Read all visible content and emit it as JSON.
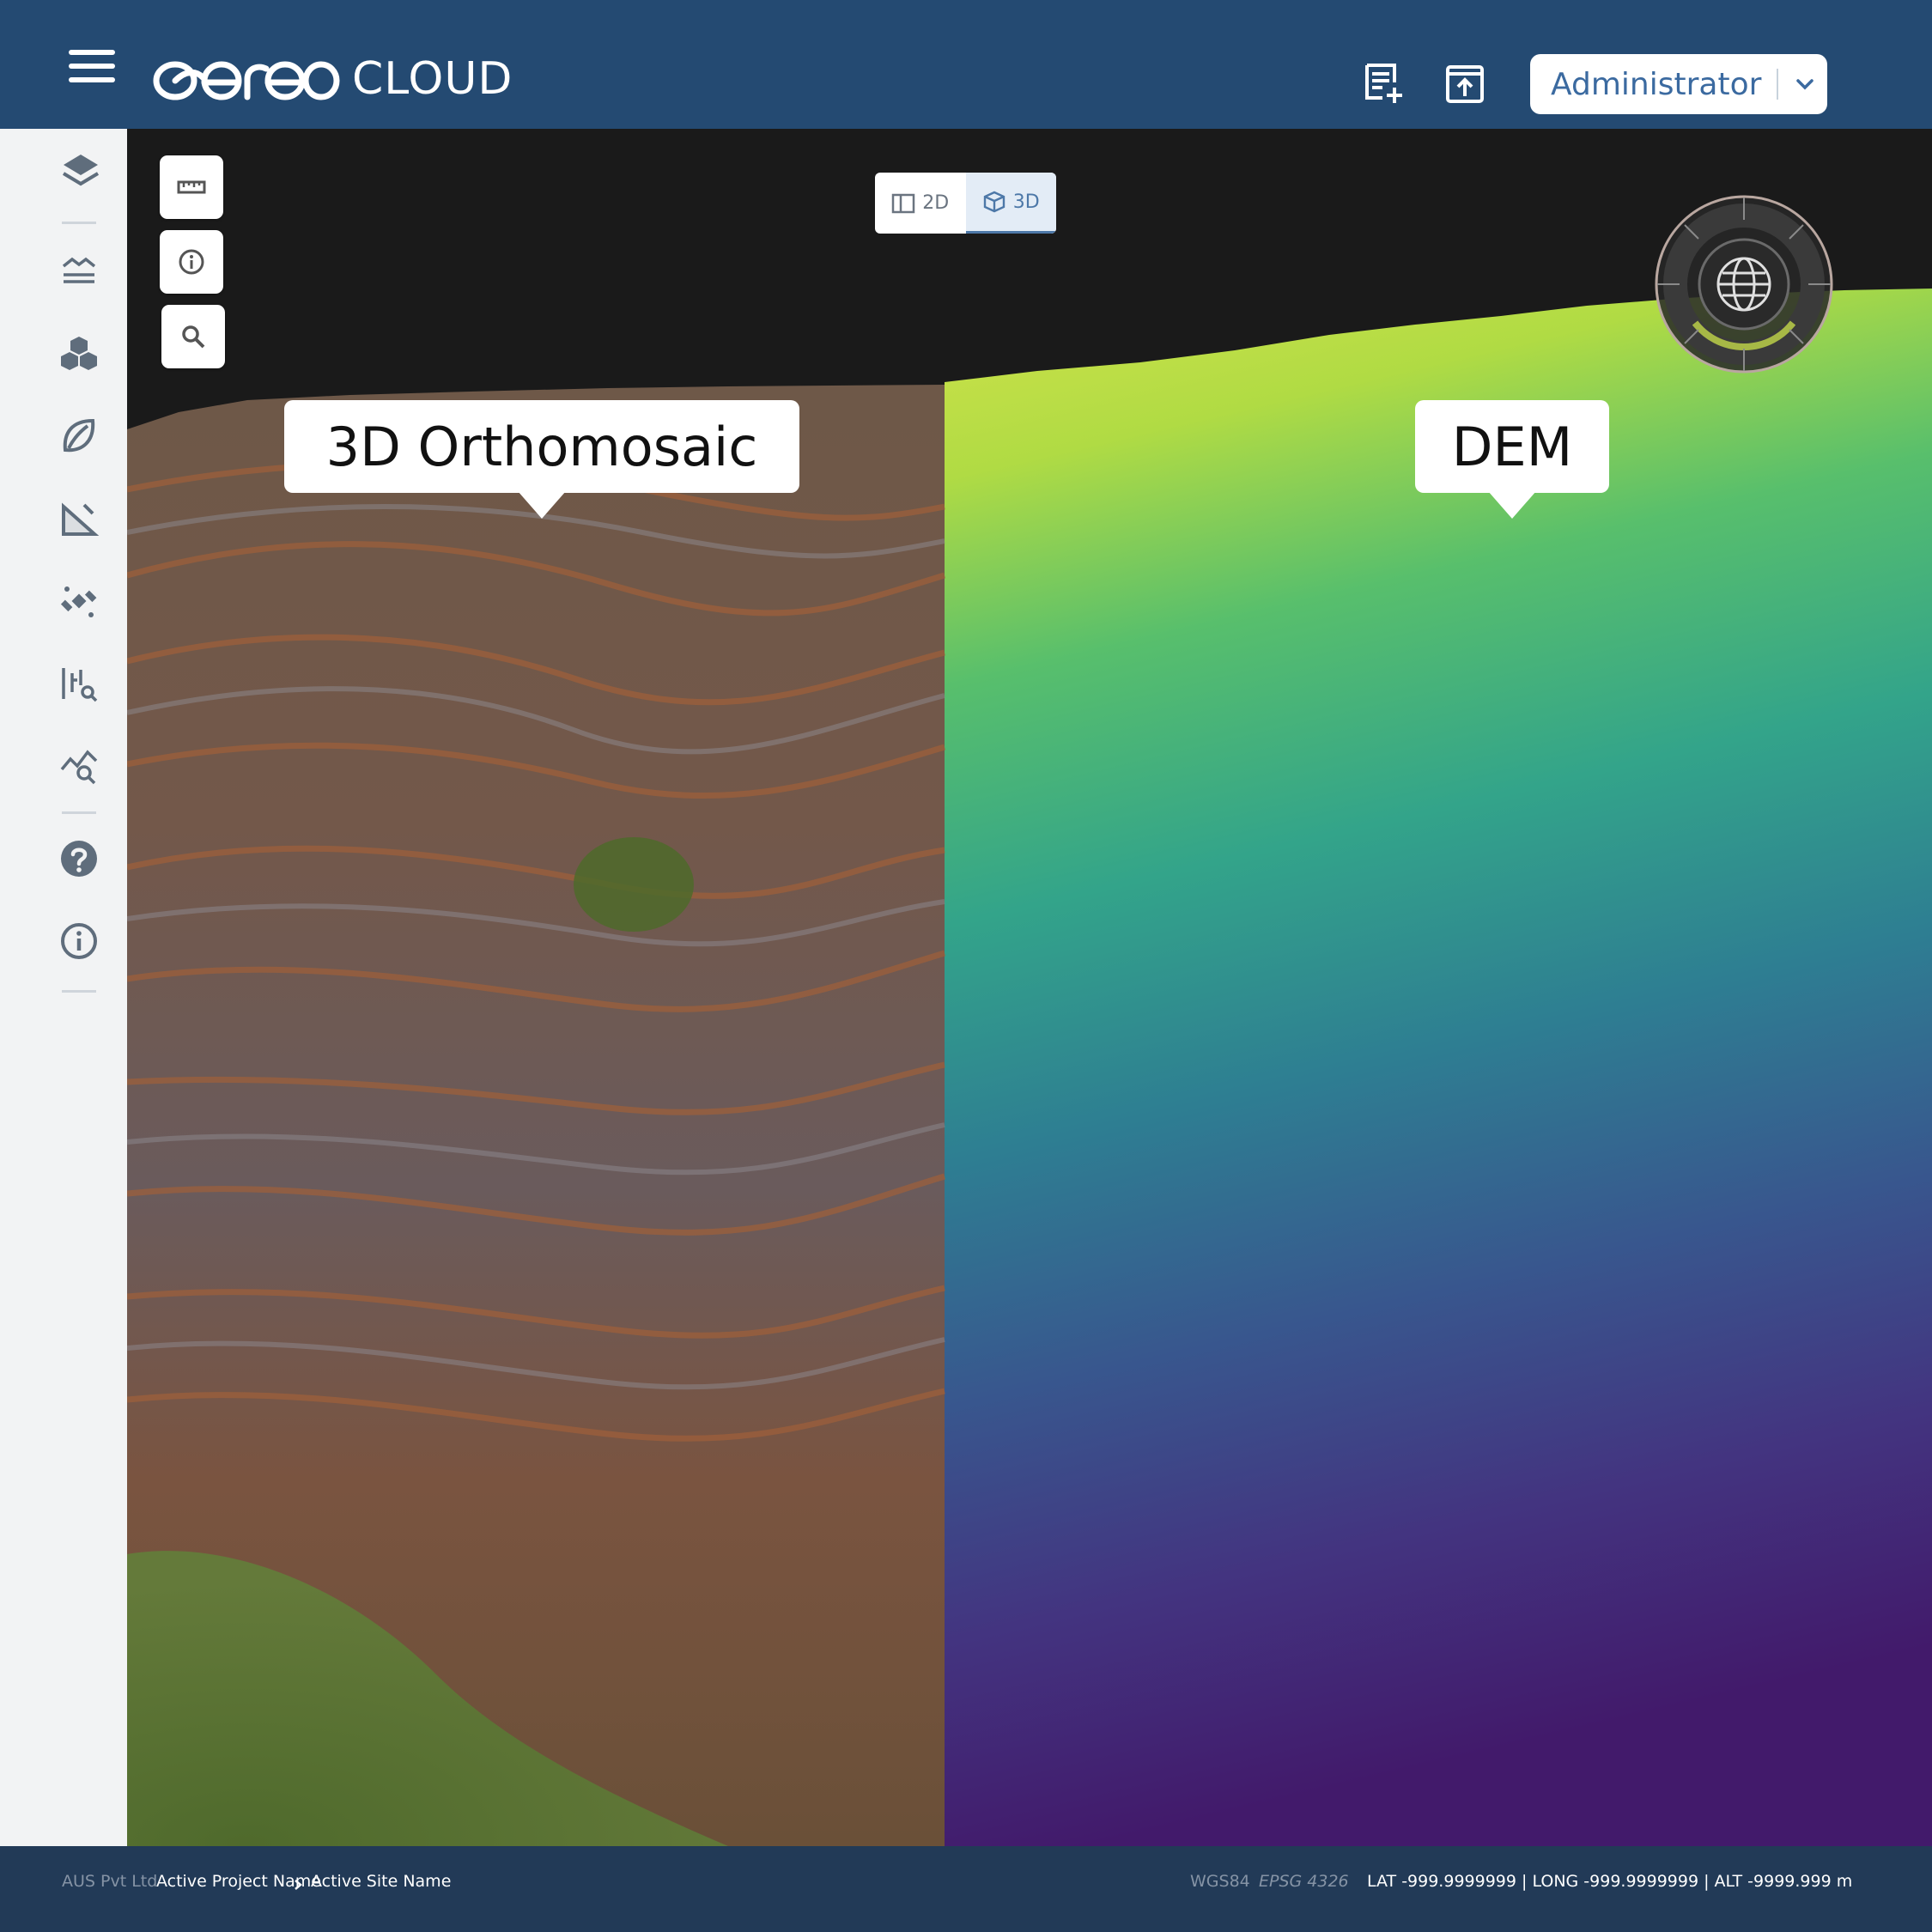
{
  "header": {
    "logo_text": "aereo",
    "logo_suffix": "CLOUD",
    "icons": [
      "menu-icon",
      "add-note-icon",
      "upload-icon"
    ],
    "user_role": "Administrator"
  },
  "sidebar": {
    "items": [
      {
        "icon": "layers-icon"
      },
      {
        "icon": "contour-icon"
      },
      {
        "icon": "boxes-icon"
      },
      {
        "icon": "leaf-icon"
      },
      {
        "icon": "slope-icon"
      },
      {
        "icon": "satellite-icon"
      },
      {
        "icon": "measure-search-icon"
      },
      {
        "icon": "chart-search-icon"
      },
      {
        "icon": "help-icon"
      },
      {
        "icon": "info-icon"
      }
    ]
  },
  "map": {
    "tools": [
      "ruler-icon",
      "info-icon",
      "search-icon"
    ],
    "view_modes": [
      "2D",
      "3D"
    ],
    "active_view": "3D",
    "left_label": "3D Orthomosaic",
    "right_label": "DEM"
  },
  "footer": {
    "company": "AUS Pvt Ltd",
    "project": "Active Project Name",
    "site": "Active Site Name",
    "crs": "WGS84",
    "epsg": "EPSG 4326",
    "coords": "LAT -999.9999999 | LONG -999.9999999 | ALT -9999.999 m"
  },
  "colors": {
    "header_bg": "#244a72",
    "footer_bg": "#223a57",
    "sidebar_bg": "#f2f3f4",
    "accent": "#3b6aa0"
  }
}
